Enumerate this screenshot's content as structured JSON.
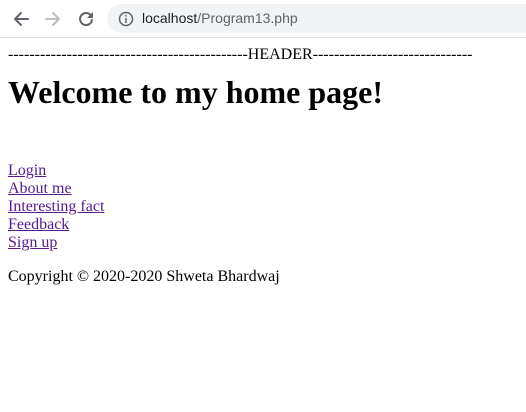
{
  "browser": {
    "url_host": "localhost",
    "url_path": "/Program13.php",
    "icons": {
      "back": "arrow-left-icon",
      "forward": "arrow-right-icon",
      "reload": "reload-icon",
      "info": "info-icon"
    },
    "colors": {
      "icon_active": "#5f6368",
      "icon_disabled": "#bdbdbd",
      "omnibox_bg": "#f1f3f4"
    }
  },
  "page": {
    "header_text": "---------------------------------------------HEADER------------------------------",
    "title": "Welcome to my home page!",
    "links": [
      {
        "label": "Login"
      },
      {
        "label": "About me"
      },
      {
        "label": "Interesting fact"
      },
      {
        "label": "Feedback"
      },
      {
        "label": "Sign up"
      }
    ],
    "copyright": "Copyright © 2020-2020 Shweta Bhardwaj",
    "colors": {
      "visited_link": "#551a8b",
      "text": "#000000"
    }
  }
}
